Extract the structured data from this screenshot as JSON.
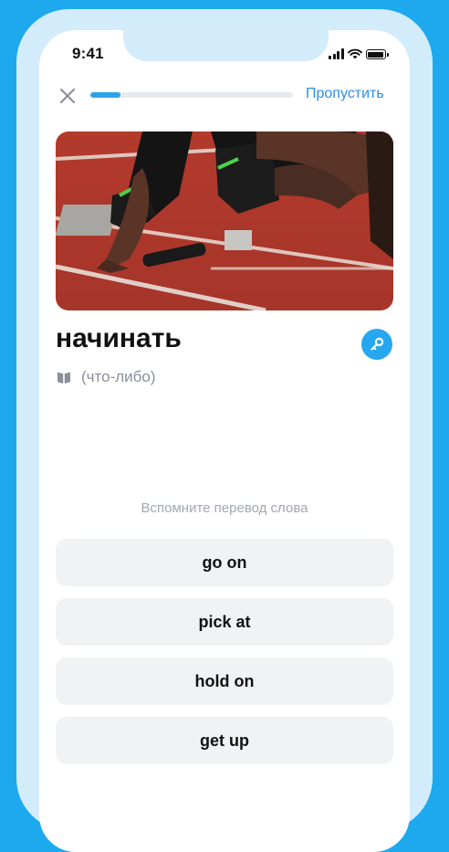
{
  "status_bar": {
    "time": "9:41",
    "icons": [
      "signal-icon",
      "wifi-icon",
      "battery-icon"
    ]
  },
  "header": {
    "close_icon": "close-icon",
    "progress": 0.15,
    "skip_label": "Пропустить"
  },
  "card": {
    "image": "runner-starting-block-photo",
    "word": "начинать",
    "key_icon": "key-icon",
    "hint_icon": "book-icon",
    "hint": "(что-либо)"
  },
  "quiz": {
    "instruction": "Вспомните перевод слова",
    "options": [
      {
        "label": "go on"
      },
      {
        "label": "pick at"
      },
      {
        "label": "hold on"
      },
      {
        "label": "get up"
      }
    ]
  },
  "colors": {
    "background": "#1ea9ef",
    "accent": "#2aa3ea",
    "link": "#2d8ee6",
    "option_bg": "#f1f2f4"
  }
}
